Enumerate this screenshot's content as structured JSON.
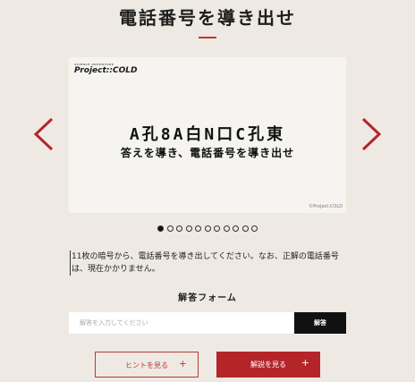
{
  "page_title": "電話番号を導き出せ",
  "carousel": {
    "logo_sub": "SCIENCE ADVENTURE",
    "logo_main": "Project::COLD",
    "cipher_text": "A孔8A白N口C孔東",
    "prompt_text": "答えを導き、電話番号を導き出せ",
    "copyright": "©Project:COLD",
    "dot_count": 11,
    "active_index": 0
  },
  "description": "11枚の暗号から、電話番号を導き出してください。なお、正解の電話番号は、現在かかりません。",
  "form": {
    "title": "解答フォーム",
    "placeholder": "解答を入力してください",
    "submit_label": "解答"
  },
  "buttons": {
    "hint_label": "ヒントを見る",
    "explain_label": "解説を見る",
    "plus": "+"
  },
  "colors": {
    "background": "#eeeae3",
    "accent": "#b4252a",
    "dark": "#111111"
  }
}
